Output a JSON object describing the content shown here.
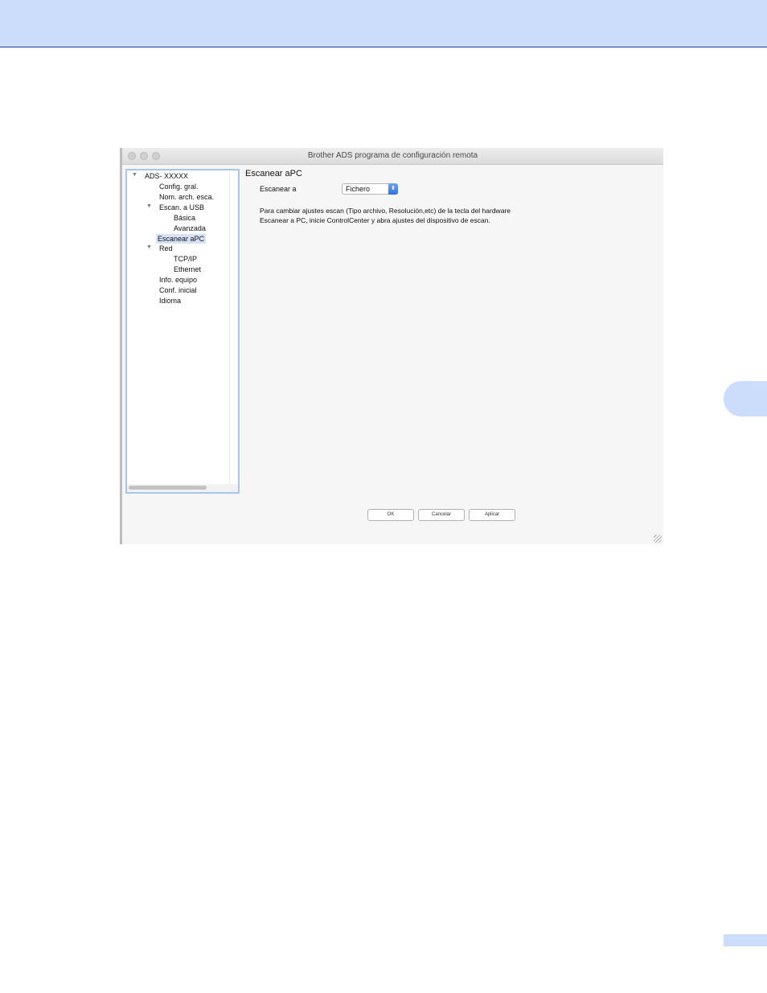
{
  "window": {
    "title": "Brother ADS programa de configuración remota"
  },
  "tree": {
    "root": "ADS- XXXXX",
    "config_gral": "Config. gral.",
    "nom_arch": "Nom. arch. esca.",
    "escan_usb": "Escan. a USB",
    "basica": "Básica",
    "avanzada": "Avanzada",
    "escanear_apc": "Escanear aPC",
    "red": "Red",
    "tcpip": "TCP/IP",
    "ethernet": "Ethernet",
    "info_equipo": "Info. equipo",
    "conf_inicial": "Conf. inicial",
    "idioma": "Idioma",
    "disclosure_glyph": "▼"
  },
  "main": {
    "section_title": "Escanear aPC",
    "field_label": "Escanear a",
    "select_value": "Fichero",
    "select_glyph": "⬍",
    "info_line1": "Para cambiar ajustes escan (Tipo archivo, Resolución,etc) de la tecla del hardware",
    "info_line2": "Escanear a PC, inicie ControlCenter y abra ajustes del dispositivo de escan."
  },
  "buttons": {
    "ok": "OK",
    "cancel": "Cancelar",
    "apply": "Aplicar"
  }
}
